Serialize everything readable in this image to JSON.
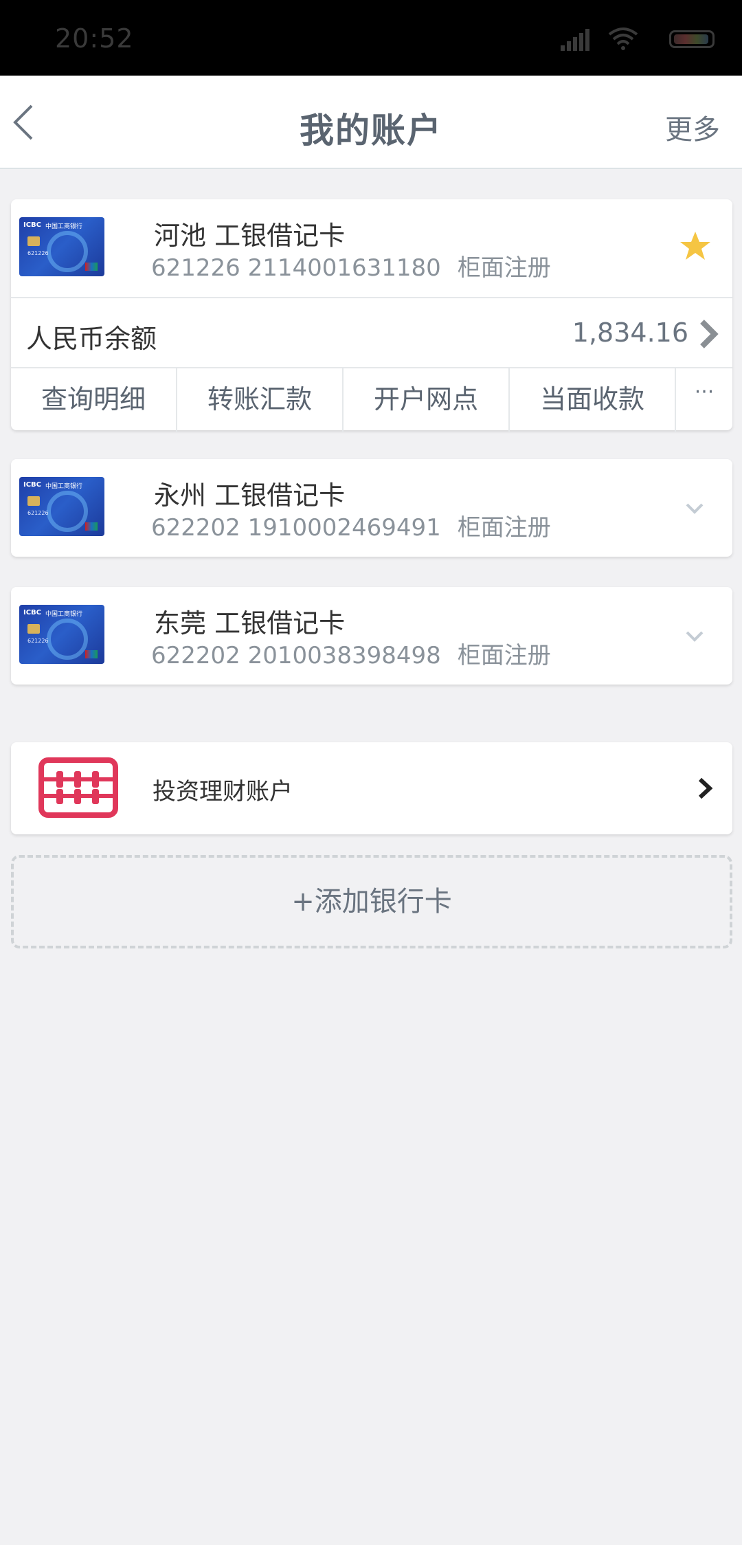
{
  "status_bar": {
    "time": "20:52"
  },
  "nav": {
    "title": "我的账户",
    "more_label": "更多"
  },
  "primary_card": {
    "name": "河池 工银借记卡",
    "number": "621226 2114001631180",
    "registration": "柜面注册",
    "balance_label": "人民币余额",
    "balance_value": "1,834.16",
    "actions": [
      "查询明细",
      "转账汇款",
      "开户网点",
      "当面收款"
    ],
    "actions_more": "···"
  },
  "cards": [
    {
      "name": "永州 工银借记卡",
      "number": "622202 1910002469491",
      "registration": "柜面注册"
    },
    {
      "name": "东莞 工银借记卡",
      "number": "622202 2010038398498",
      "registration": "柜面注册"
    }
  ],
  "investment": {
    "label": "投资理财账户"
  },
  "add_card": {
    "label": "+添加银行卡"
  },
  "card_image": {
    "logo": "ICBC",
    "bank": "中国工商银行",
    "number_prefix": "621226"
  },
  "colors": {
    "star": "#f5c543",
    "abacus": "#e0375a",
    "title": "#5a6470"
  }
}
